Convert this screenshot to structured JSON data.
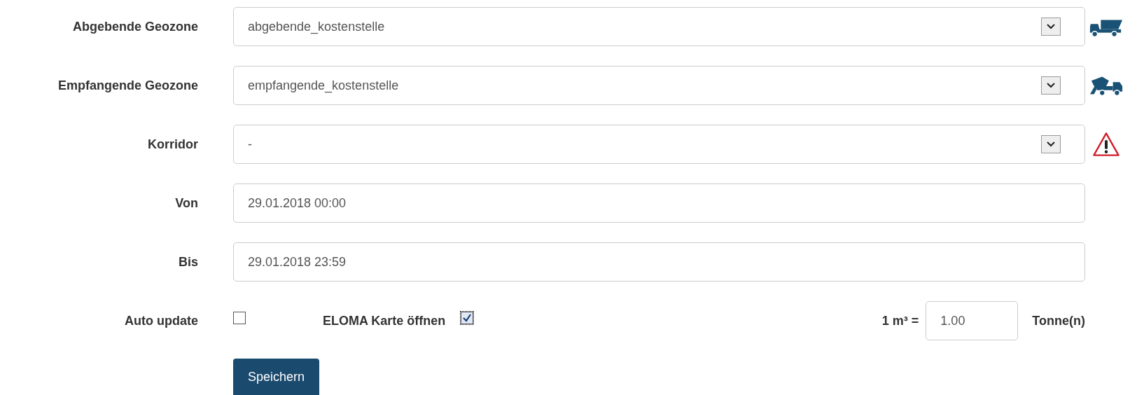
{
  "fields": [
    {
      "label": "Abgebende Geozone",
      "kind": "select",
      "value": "abgebende_kostenstelle"
    },
    {
      "label": "Empfangende Geozone",
      "kind": "select",
      "value": "empfangende_kostenstelle"
    },
    {
      "label": "Korridor",
      "kind": "select",
      "value": "-"
    },
    {
      "label": "Von",
      "kind": "text",
      "value": "29.01.2018 00:00"
    },
    {
      "label": "Bis",
      "kind": "text",
      "value": "29.01.2018 23:59"
    }
  ],
  "auto_update": {
    "label": "Auto update",
    "checked": false
  },
  "eloma": {
    "label": "ELOMA Karte öffnen",
    "checked": true
  },
  "factor": {
    "label": "1 m³ =",
    "value": "1.00",
    "unit": "Tonne(n)"
  },
  "save_button": "Speichern"
}
